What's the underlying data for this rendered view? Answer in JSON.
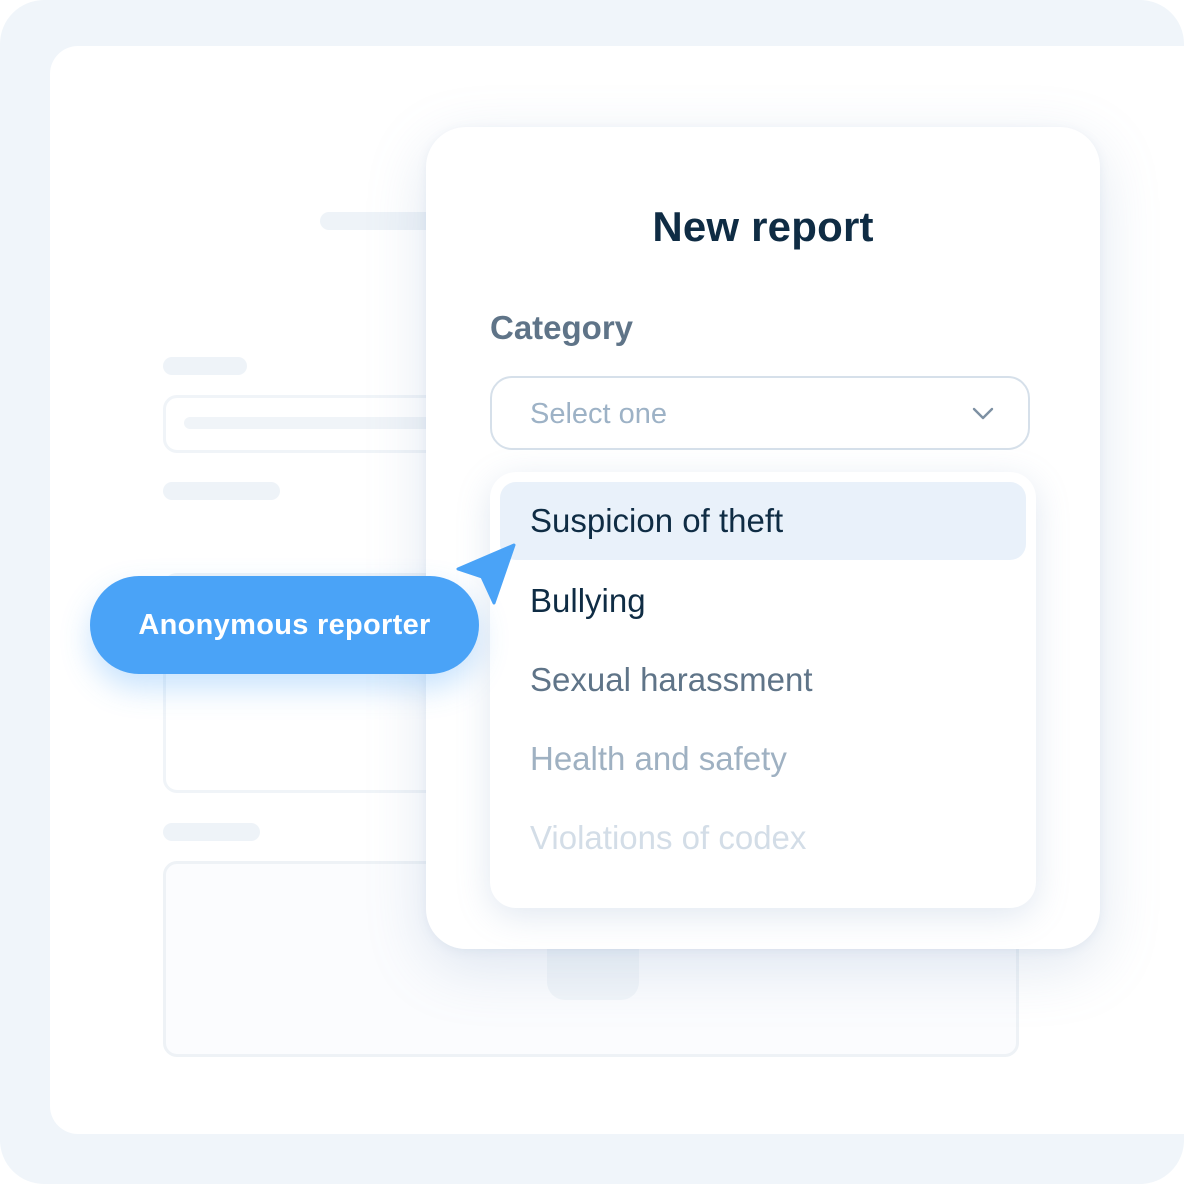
{
  "form": {
    "title": "New report",
    "category_label": "Category",
    "select": {
      "placeholder": "Select one",
      "icon": "chevron-down-icon"
    },
    "options": [
      {
        "label": "Suspicion of theft",
        "color": "#0f2c44",
        "highlighted": true
      },
      {
        "label": "Bullying",
        "color": "#0f2c44",
        "highlighted": false
      },
      {
        "label": "Sexual harassment",
        "color": "#5f7488",
        "highlighted": false
      },
      {
        "label": "Health and safety",
        "color": "#9fb1c2",
        "highlighted": false
      },
      {
        "label": "Violations of codex",
        "color": "#d3dde7",
        "highlighted": false
      }
    ]
  },
  "reporter_badge": {
    "label": "Anonymous reporter",
    "color": "#4aa3f7"
  },
  "cursor": {
    "icon": "pointer-arrow-icon",
    "color": "#4aa3f7"
  },
  "colors": {
    "title": "#0f2c44",
    "label": "#5f7488",
    "placeholder": "#9db2c6",
    "highlight_bg": "#e9f1fa",
    "frame_bg": "#f0f5fa"
  }
}
